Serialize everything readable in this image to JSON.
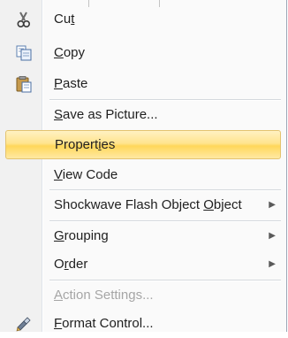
{
  "menu": {
    "items": [
      {
        "pre": "Cu",
        "key": "t",
        "post": "",
        "disabled": false,
        "submenu": false,
        "icon": "scissors-icon"
      },
      {
        "pre": "",
        "key": "C",
        "post": "opy",
        "disabled": false,
        "submenu": false,
        "icon": "copy-icon"
      },
      {
        "pre": "",
        "key": "P",
        "post": "aste",
        "disabled": false,
        "submenu": false,
        "icon": "paste-icon"
      },
      {
        "pre": "",
        "key": "S",
        "post": "ave as Picture...",
        "disabled": false,
        "submenu": false
      },
      {
        "pre": "Propert",
        "key": "i",
        "post": "es",
        "disabled": false,
        "submenu": false,
        "highlighted": true
      },
      {
        "pre": "",
        "key": "V",
        "post": "iew Code",
        "disabled": false,
        "submenu": false
      },
      {
        "pre": "Shockwave Flash Object ",
        "key": "O",
        "post": "bject",
        "disabled": false,
        "submenu": true
      },
      {
        "pre": "",
        "key": "G",
        "post": "rouping",
        "disabled": false,
        "submenu": true
      },
      {
        "pre": "O",
        "key": "r",
        "post": "der",
        "disabled": false,
        "submenu": true
      },
      {
        "pre": "",
        "key": "A",
        "post": "ction Settings...",
        "disabled": true,
        "submenu": false
      },
      {
        "pre": "",
        "key": "F",
        "post": "ormat Control...",
        "disabled": false,
        "submenu": false,
        "icon": "format-control-icon"
      }
    ],
    "submenu_glyph": "▶"
  }
}
